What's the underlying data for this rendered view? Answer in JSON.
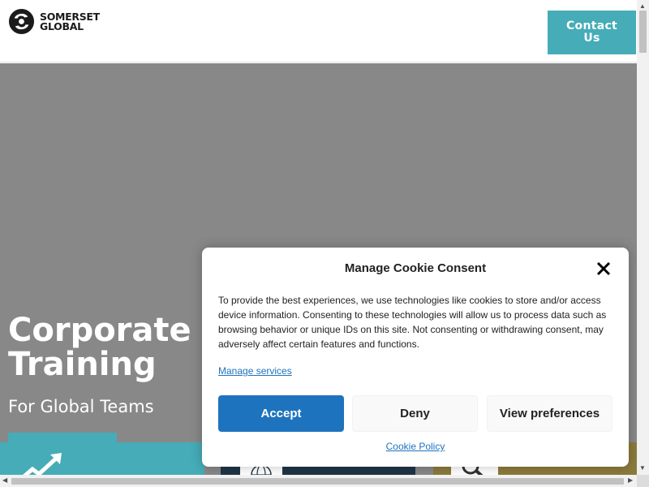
{
  "header": {
    "logo_line1": "SOMERSET",
    "logo_line2": "GLOBAL",
    "contact_label": "Contact Us"
  },
  "hero": {
    "title": "Corporate C\nTraining",
    "subtitle": "For Global Teams"
  },
  "cookie_modal": {
    "title": "Manage Cookie Consent",
    "body": "To provide the best experiences, we use technologies like cookies to store and/or access device information. Consenting to these technologies will allow us to process data such as browsing behavior or unique IDs on this site. Not consenting or withdrawing consent, may adversely affect certain features and functions.",
    "manage_services": "Manage services",
    "accept_label": "Accept",
    "deny_label": "Deny",
    "preferences_label": "View preferences",
    "policy_link": "Cookie Policy"
  },
  "icons": {
    "logo": "somerset-global-logo-icon",
    "close": "close-icon",
    "chart": "trend-up-chart-icon",
    "globe": "globe-icon",
    "search": "magnifier-icon"
  },
  "colors": {
    "accent": "#45acb8",
    "primary_button": "#1e73be",
    "hero_background": "#888888",
    "dark_card": "#1f3446",
    "gold_card": "#8c7a3c"
  }
}
